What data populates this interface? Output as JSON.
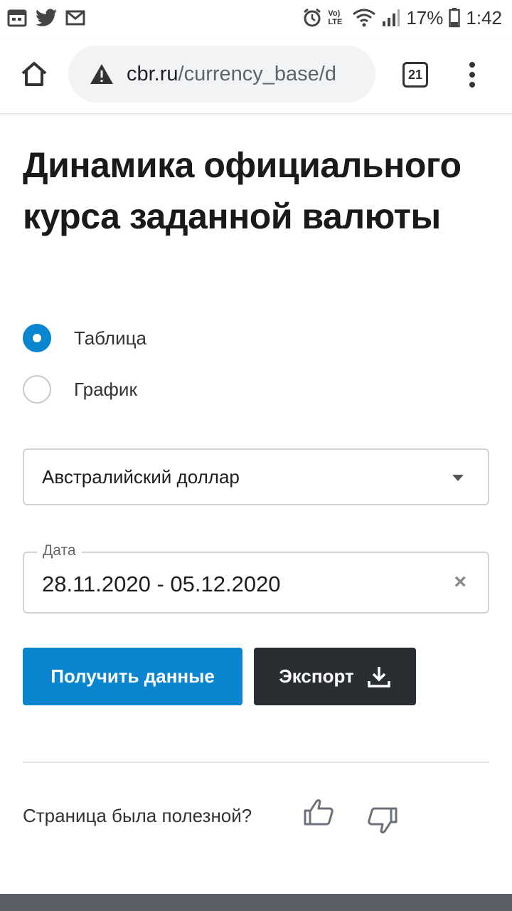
{
  "status_bar": {
    "battery_percent": "17%",
    "time": "1:42",
    "lte_label": "Vo) LTE"
  },
  "browser": {
    "url_domain": "cbr.ru",
    "url_path": "/currency_base/d",
    "tab_count": "21"
  },
  "page": {
    "title": "Динамика официального курса заданной валюты",
    "view_options": [
      {
        "label": "Таблица",
        "selected": true
      },
      {
        "label": "График",
        "selected": false
      }
    ],
    "currency_select": {
      "value": "Австралийский доллар"
    },
    "date_field": {
      "label": "Дата",
      "value": "28.11.2020 - 05.12.2020"
    },
    "buttons": {
      "get_data": "Получить данные",
      "export": "Экспорт"
    },
    "feedback": {
      "question": "Страница была полезной?"
    }
  },
  "colors": {
    "primary": "#0a86d0",
    "dark_button": "#2a2d32",
    "text": "#1e1e1e"
  }
}
